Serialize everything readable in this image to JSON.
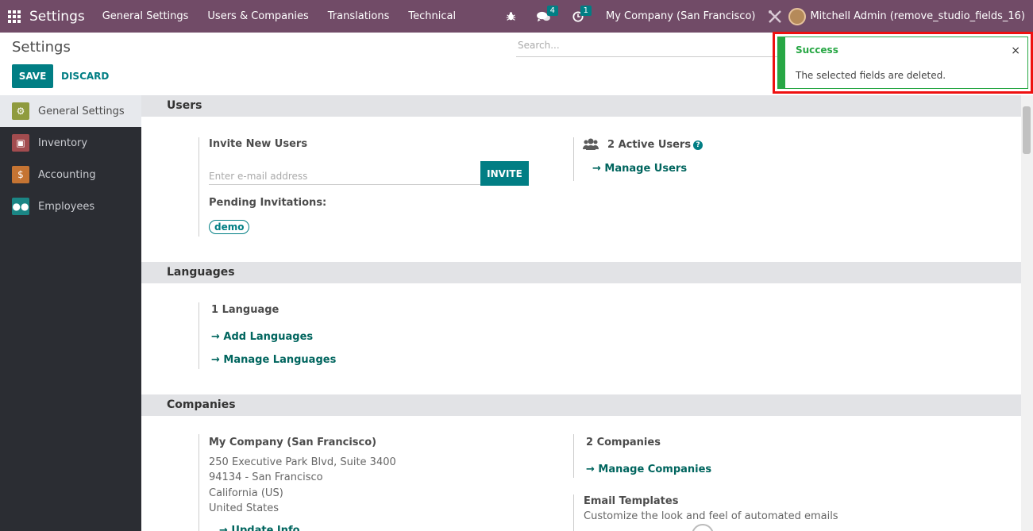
{
  "navbar": {
    "app_title": "Settings",
    "menu": [
      "General Settings",
      "Users & Companies",
      "Translations",
      "Technical"
    ],
    "messages_badge": "4",
    "activity_badge": "1",
    "company": "My Company (San Francisco)",
    "user": "Mitchell Admin (remove_studio_fields_16)"
  },
  "control_panel": {
    "title": "Settings",
    "save_label": "SAVE",
    "discard_label": "DISCARD",
    "search_placeholder": "Search..."
  },
  "sidebar": {
    "items": [
      {
        "label": "General Settings",
        "color": "#8f9b3e"
      },
      {
        "label": "Inventory",
        "color": "#a24c4f"
      },
      {
        "label": "Accounting",
        "color": "#c57433"
      },
      {
        "label": "Employees",
        "color": "#1b8685"
      }
    ]
  },
  "users": {
    "header": "Users",
    "invite_label": "Invite New Users",
    "email_placeholder": "Enter e-mail address",
    "invite_button": "INVITE",
    "pending_label": "Pending Invitations:",
    "pending_tag": "demo",
    "active_users": "2 Active Users",
    "manage_users": "Manage Users"
  },
  "languages": {
    "header": "Languages",
    "count": "1 Language",
    "add": "Add Languages",
    "manage": "Manage Languages"
  },
  "companies": {
    "header": "Companies",
    "company_name": "My Company (San Francisco)",
    "address1": "250 Executive Park Blvd, Suite 3400",
    "address2": "94134 - San Francisco",
    "address3": "California (US)",
    "address4": "United States",
    "update_info": "Update Info",
    "count": "2 Companies",
    "manage": "Manage Companies",
    "email_templates": "Email Templates",
    "email_templates_desc": "Customize the look and feel of automated emails"
  },
  "toast": {
    "title": "Success",
    "message": "The selected fields are deleted.",
    "close": "×"
  }
}
